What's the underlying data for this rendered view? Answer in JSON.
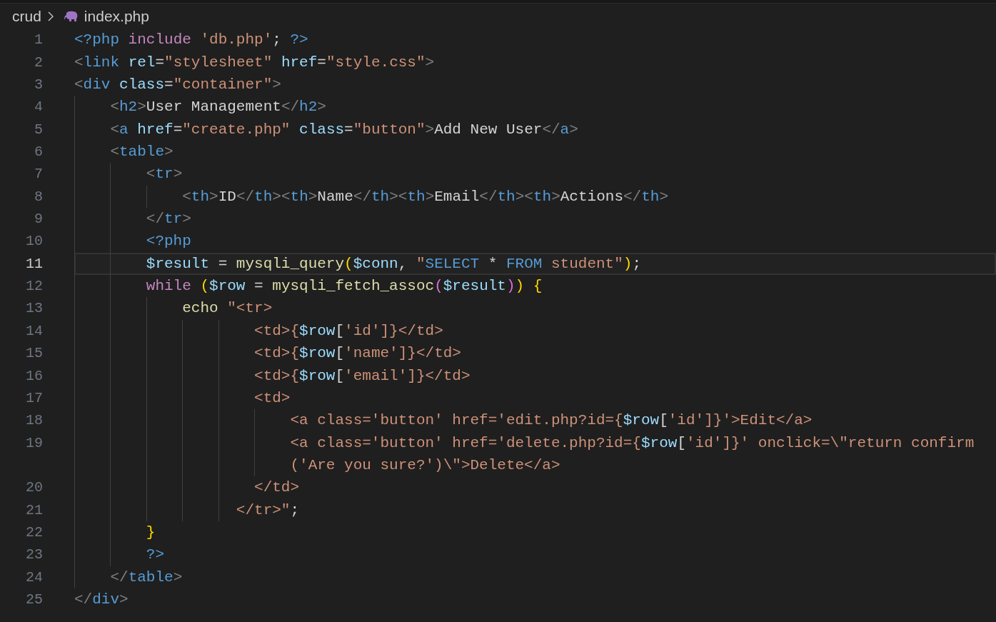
{
  "breadcrumb": {
    "folder": "crud",
    "file": "index.php"
  },
  "lines": [
    {
      "number": "1",
      "current": false,
      "tokens": [
        {
          "kind": "php",
          "t": "<?php"
        },
        {
          "kind": "kw",
          "t": " include"
        },
        {
          "kind": "str",
          "t": " 'db.php'"
        },
        {
          "kind": "plain",
          "t": "; "
        },
        {
          "kind": "php",
          "t": "?>"
        }
      ]
    },
    {
      "number": "2",
      "current": false,
      "tokens": [
        {
          "kind": "punct",
          "t": "<"
        },
        {
          "kind": "tag",
          "t": "link"
        },
        {
          "kind": "attr",
          "t": " rel"
        },
        {
          "kind": "plain",
          "t": "="
        },
        {
          "kind": "str",
          "t": "\"stylesheet\""
        },
        {
          "kind": "attr",
          "t": " href"
        },
        {
          "kind": "plain",
          "t": "="
        },
        {
          "kind": "str",
          "t": "\"style.css\""
        },
        {
          "kind": "punct",
          "t": ">"
        }
      ]
    },
    {
      "number": "3",
      "current": false,
      "tokens": [
        {
          "kind": "punct",
          "t": "<"
        },
        {
          "kind": "tag",
          "t": "div"
        },
        {
          "kind": "attr",
          "t": " class"
        },
        {
          "kind": "plain",
          "t": "="
        },
        {
          "kind": "str",
          "t": "\"container\""
        },
        {
          "kind": "punct",
          "t": ">"
        }
      ]
    },
    {
      "number": "4",
      "current": false,
      "tokens": [
        {
          "kind": "punct",
          "t": "    <"
        },
        {
          "kind": "tag",
          "t": "h2"
        },
        {
          "kind": "punct",
          "t": ">"
        },
        {
          "kind": "plain",
          "t": "User Management"
        },
        {
          "kind": "punct",
          "t": "</"
        },
        {
          "kind": "tag",
          "t": "h2"
        },
        {
          "kind": "punct",
          "t": ">"
        }
      ]
    },
    {
      "number": "5",
      "current": false,
      "tokens": [
        {
          "kind": "punct",
          "t": "    <"
        },
        {
          "kind": "tag",
          "t": "a"
        },
        {
          "kind": "attr",
          "t": " href"
        },
        {
          "kind": "plain",
          "t": "="
        },
        {
          "kind": "str",
          "t": "\"create.php\""
        },
        {
          "kind": "attr",
          "t": " class"
        },
        {
          "kind": "plain",
          "t": "="
        },
        {
          "kind": "str",
          "t": "\"button\""
        },
        {
          "kind": "punct",
          "t": ">"
        },
        {
          "kind": "plain",
          "t": "Add New User"
        },
        {
          "kind": "punct",
          "t": "</"
        },
        {
          "kind": "tag",
          "t": "a"
        },
        {
          "kind": "punct",
          "t": ">"
        }
      ]
    },
    {
      "number": "6",
      "current": false,
      "tokens": [
        {
          "kind": "punct",
          "t": "    <"
        },
        {
          "kind": "tag",
          "t": "table"
        },
        {
          "kind": "punct",
          "t": ">"
        }
      ]
    },
    {
      "number": "7",
      "current": false,
      "tokens": [
        {
          "kind": "punct",
          "t": "        <"
        },
        {
          "kind": "tag",
          "t": "tr"
        },
        {
          "kind": "punct",
          "t": ">"
        }
      ]
    },
    {
      "number": "8",
      "current": false,
      "tokens": [
        {
          "kind": "punct",
          "t": "            <"
        },
        {
          "kind": "tag",
          "t": "th"
        },
        {
          "kind": "punct",
          "t": ">"
        },
        {
          "kind": "plain",
          "t": "ID"
        },
        {
          "kind": "punct",
          "t": "</"
        },
        {
          "kind": "tag",
          "t": "th"
        },
        {
          "kind": "punct",
          "t": "><"
        },
        {
          "kind": "tag",
          "t": "th"
        },
        {
          "kind": "punct",
          "t": ">"
        },
        {
          "kind": "plain",
          "t": "Name"
        },
        {
          "kind": "punct",
          "t": "</"
        },
        {
          "kind": "tag",
          "t": "th"
        },
        {
          "kind": "punct",
          "t": "><"
        },
        {
          "kind": "tag",
          "t": "th"
        },
        {
          "kind": "punct",
          "t": ">"
        },
        {
          "kind": "plain",
          "t": "Email"
        },
        {
          "kind": "punct",
          "t": "</"
        },
        {
          "kind": "tag",
          "t": "th"
        },
        {
          "kind": "punct",
          "t": "><"
        },
        {
          "kind": "tag",
          "t": "th"
        },
        {
          "kind": "punct",
          "t": ">"
        },
        {
          "kind": "plain",
          "t": "Actions"
        },
        {
          "kind": "punct",
          "t": "</"
        },
        {
          "kind": "tag",
          "t": "th"
        },
        {
          "kind": "punct",
          "t": ">"
        }
      ]
    },
    {
      "number": "9",
      "current": false,
      "tokens": [
        {
          "kind": "punct",
          "t": "        </"
        },
        {
          "kind": "tag",
          "t": "tr"
        },
        {
          "kind": "punct",
          "t": ">"
        }
      ]
    },
    {
      "number": "10",
      "current": false,
      "tokens": [
        {
          "kind": "php",
          "t": "        <?php"
        }
      ]
    },
    {
      "number": "11",
      "current": true,
      "tokens": [
        {
          "kind": "var",
          "t": "        $result"
        },
        {
          "kind": "plain",
          "t": " = "
        },
        {
          "kind": "fn",
          "t": "mysqli_query"
        },
        {
          "kind": "p1",
          "t": "("
        },
        {
          "kind": "var",
          "t": "$conn"
        },
        {
          "kind": "plain",
          "t": ", "
        },
        {
          "kind": "str",
          "t": "\""
        },
        {
          "kind": "sql",
          "t": "SELECT"
        },
        {
          "kind": "plain",
          "t": " * "
        },
        {
          "kind": "sql",
          "t": "FROM"
        },
        {
          "kind": "str",
          "t": " student\""
        },
        {
          "kind": "p1",
          "t": ")"
        },
        {
          "kind": "plain",
          "t": ";"
        }
      ]
    },
    {
      "number": "12",
      "current": false,
      "tokens": [
        {
          "kind": "kw",
          "t": "        while"
        },
        {
          "kind": "p1",
          "t": " ("
        },
        {
          "kind": "var",
          "t": "$row"
        },
        {
          "kind": "plain",
          "t": " = "
        },
        {
          "kind": "fn",
          "t": "mysqli_fetch_assoc"
        },
        {
          "kind": "p2",
          "t": "("
        },
        {
          "kind": "var",
          "t": "$result"
        },
        {
          "kind": "p2",
          "t": ")"
        },
        {
          "kind": "p1",
          "t": ")"
        },
        {
          "kind": "p1",
          "t": " {"
        }
      ]
    },
    {
      "number": "13",
      "current": false,
      "tokens": [
        {
          "kind": "fn",
          "t": "            echo"
        },
        {
          "kind": "str",
          "t": " \"<tr>"
        }
      ]
    },
    {
      "number": "14",
      "current": false,
      "tokens": [
        {
          "kind": "str",
          "t": "                    <td>{"
        },
        {
          "kind": "var",
          "t": "$row"
        },
        {
          "kind": "plain",
          "t": "["
        },
        {
          "kind": "str",
          "t": "'id'"
        },
        {
          "kind": "str",
          "t": "]}</td>"
        }
      ]
    },
    {
      "number": "15",
      "current": false,
      "tokens": [
        {
          "kind": "str",
          "t": "                    <td>{"
        },
        {
          "kind": "var",
          "t": "$row"
        },
        {
          "kind": "plain",
          "t": "["
        },
        {
          "kind": "str",
          "t": "'name'"
        },
        {
          "kind": "str",
          "t": "]}</td>"
        }
      ]
    },
    {
      "number": "16",
      "current": false,
      "tokens": [
        {
          "kind": "str",
          "t": "                    <td>{"
        },
        {
          "kind": "var",
          "t": "$row"
        },
        {
          "kind": "plain",
          "t": "["
        },
        {
          "kind": "str",
          "t": "'email'"
        },
        {
          "kind": "str",
          "t": "]}</td>"
        }
      ]
    },
    {
      "number": "17",
      "current": false,
      "tokens": [
        {
          "kind": "str",
          "t": "                    <td>"
        }
      ]
    },
    {
      "number": "18",
      "current": false,
      "tokens": [
        {
          "kind": "str",
          "t": "                        <a class='button' href='edit.php?id={"
        },
        {
          "kind": "var",
          "t": "$row"
        },
        {
          "kind": "plain",
          "t": "["
        },
        {
          "kind": "str",
          "t": "'id'"
        },
        {
          "kind": "str",
          "t": "]}'>Edit</a>"
        }
      ]
    },
    {
      "number": "19",
      "current": false,
      "tokens": [
        {
          "kind": "str",
          "t": "                        <a class='button' href='delete.php?id={"
        },
        {
          "kind": "var",
          "t": "$row"
        },
        {
          "kind": "plain",
          "t": "["
        },
        {
          "kind": "str",
          "t": "'id'"
        },
        {
          "kind": "str",
          "t": "]}' onclick=\\\"return confirm"
        }
      ]
    },
    {
      "current": false,
      "tokens": [
        {
          "kind": "str",
          "t": "                        ('Are you sure?')\\\">Delete</a>"
        }
      ]
    },
    {
      "number": "20",
      "current": false,
      "tokens": [
        {
          "kind": "str",
          "t": "                    </td>"
        }
      ]
    },
    {
      "number": "21",
      "current": false,
      "tokens": [
        {
          "kind": "str",
          "t": "                  </tr>\""
        },
        {
          "kind": "plain",
          "t": ";"
        }
      ]
    },
    {
      "number": "22",
      "current": false,
      "tokens": [
        {
          "kind": "p1",
          "t": "        }"
        }
      ]
    },
    {
      "number": "23",
      "current": false,
      "tokens": [
        {
          "kind": "php",
          "t": "        ?>"
        }
      ]
    },
    {
      "number": "24",
      "current": false,
      "tokens": [
        {
          "kind": "punct",
          "t": "    </"
        },
        {
          "kind": "tag",
          "t": "table"
        },
        {
          "kind": "punct",
          "t": ">"
        }
      ]
    },
    {
      "number": "25",
      "current": false,
      "tokens": [
        {
          "kind": "punct",
          "t": "</"
        },
        {
          "kind": "tag",
          "t": "div"
        },
        {
          "kind": "punct",
          "t": ">"
        }
      ]
    }
  ]
}
